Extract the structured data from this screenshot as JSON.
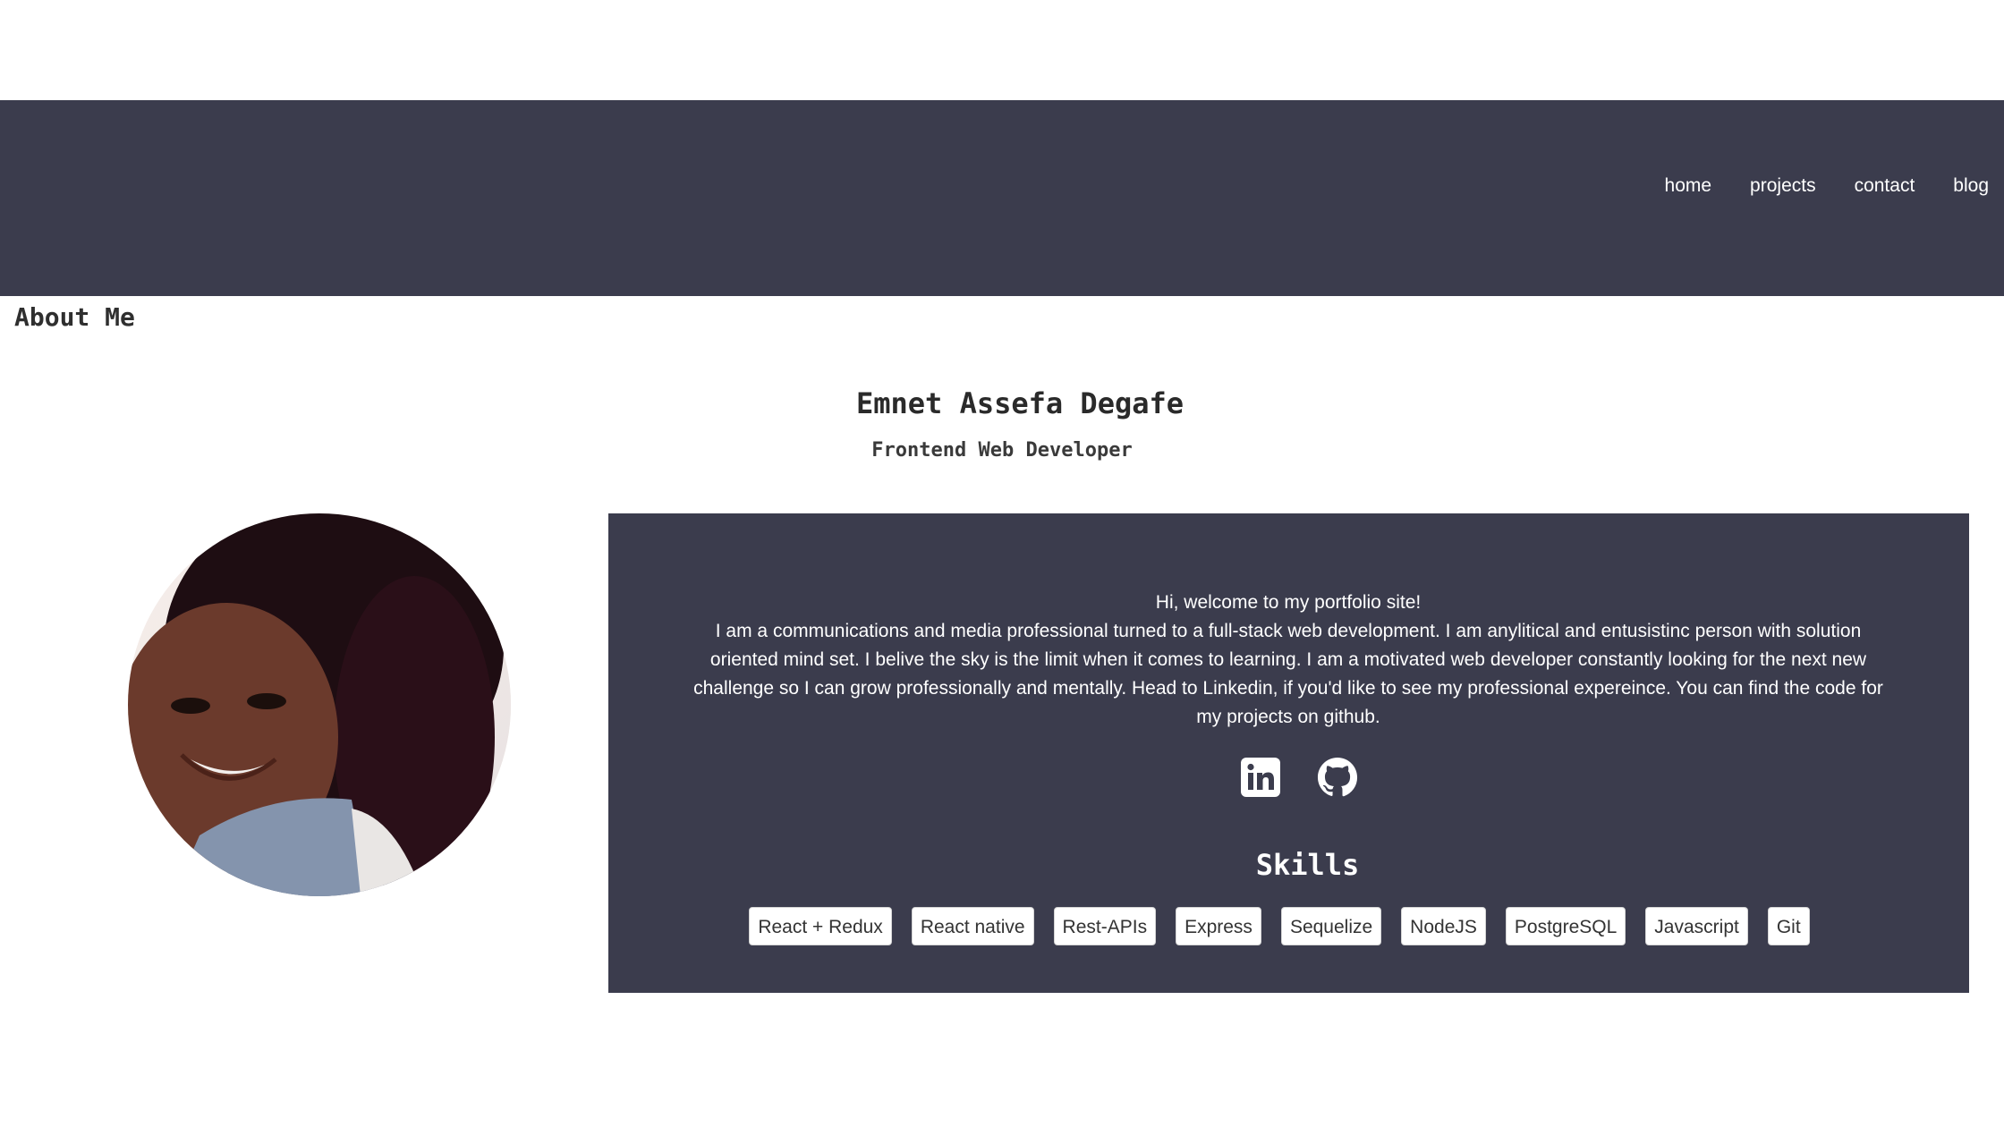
{
  "nav": {
    "items": [
      {
        "label": "home"
      },
      {
        "label": "projects"
      },
      {
        "label": "contact"
      },
      {
        "label": "blog"
      }
    ]
  },
  "about": {
    "heading": "About Me",
    "name": "Emnet Assefa Degafe",
    "role": "Frontend Web Developer",
    "greeting": "Hi, welcome to my portfolio site!",
    "bio": "I am a communications and media professional turned to a full-stack web development. I am anylitical and entusistinc person with solution oriented mind set. I belive the sky is the limit when it comes to learning. I am a motivated web developer constantly looking for the next new challenge so I can grow professionally and mentally. Head to Linkedin, if you'd like to see my professional expereince. You can find the code for my projects on github."
  },
  "social": {
    "links": [
      {
        "icon": "linkedin-icon"
      },
      {
        "icon": "github-icon"
      }
    ]
  },
  "skills": {
    "title": "Skills",
    "items": [
      "React + Redux",
      "React native",
      "Rest-APIs",
      "Express",
      "Sequelize",
      "NodeJS",
      "PostgreSQL",
      "Javascript",
      "Git"
    ]
  },
  "colors": {
    "navbar_bg": "#3b3c4d",
    "card_bg": "#3b3c4d",
    "text_light": "#ffffff",
    "text_dark": "#2f2f2f"
  }
}
